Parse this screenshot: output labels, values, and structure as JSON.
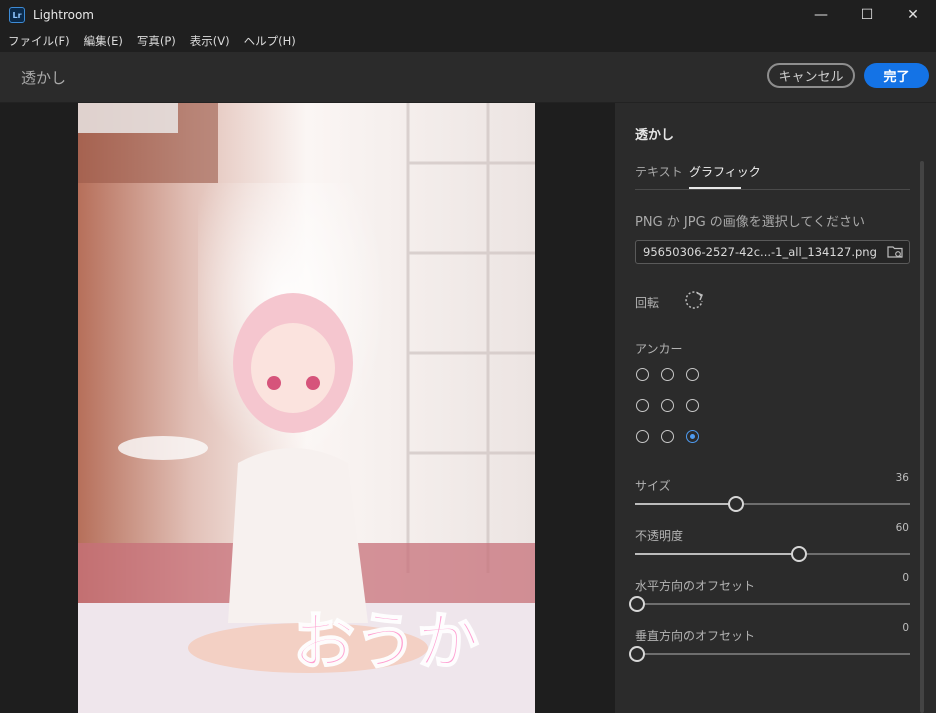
{
  "window": {
    "app_icon_text": "Lr",
    "title": "Lightroom",
    "controls": {
      "minimize": "—",
      "maximize": "☐",
      "close": "✕"
    }
  },
  "menu": [
    "ファイル(F)",
    "編集(E)",
    "写真(P)",
    "表示(V)",
    "ヘルプ(H)"
  ],
  "header": {
    "title": "透かし",
    "cancel_label": "キャンセル",
    "done_label": "完了"
  },
  "colors": {
    "accent": "#1473e6",
    "selected_radio": "#4e9bf0",
    "panel_bg": "#2b2b2b"
  },
  "panel": {
    "title": "透かし",
    "tabs": [
      {
        "label": "テキスト",
        "active": false
      },
      {
        "label": "グラフィック",
        "active": true
      }
    ],
    "file_prompt": "PNG か JPG の画像を選択してください",
    "file_name": "95650306-2527-42c...-1_all_134127.png",
    "folder_icon": "folder-search-icon",
    "rotate_label": "回転",
    "rotate_icon": "rotate-icon",
    "anchor_label": "アンカー",
    "anchor_selected": "bottom-right",
    "sliders": {
      "size": {
        "label": "サイズ",
        "value": "36",
        "fraction": 0.36
      },
      "opacity": {
        "label": "不透明度",
        "value": "60",
        "fraction": 0.59
      },
      "h_offset": {
        "label": "水平方向のオフセット",
        "value": "0",
        "fraction": 0.0
      },
      "v_offset": {
        "label": "垂直方向のオフセット",
        "value": "0",
        "fraction": 0.0
      }
    }
  },
  "photo": {
    "description_icon": "photo-preview",
    "watermark_text": "おうか"
  }
}
